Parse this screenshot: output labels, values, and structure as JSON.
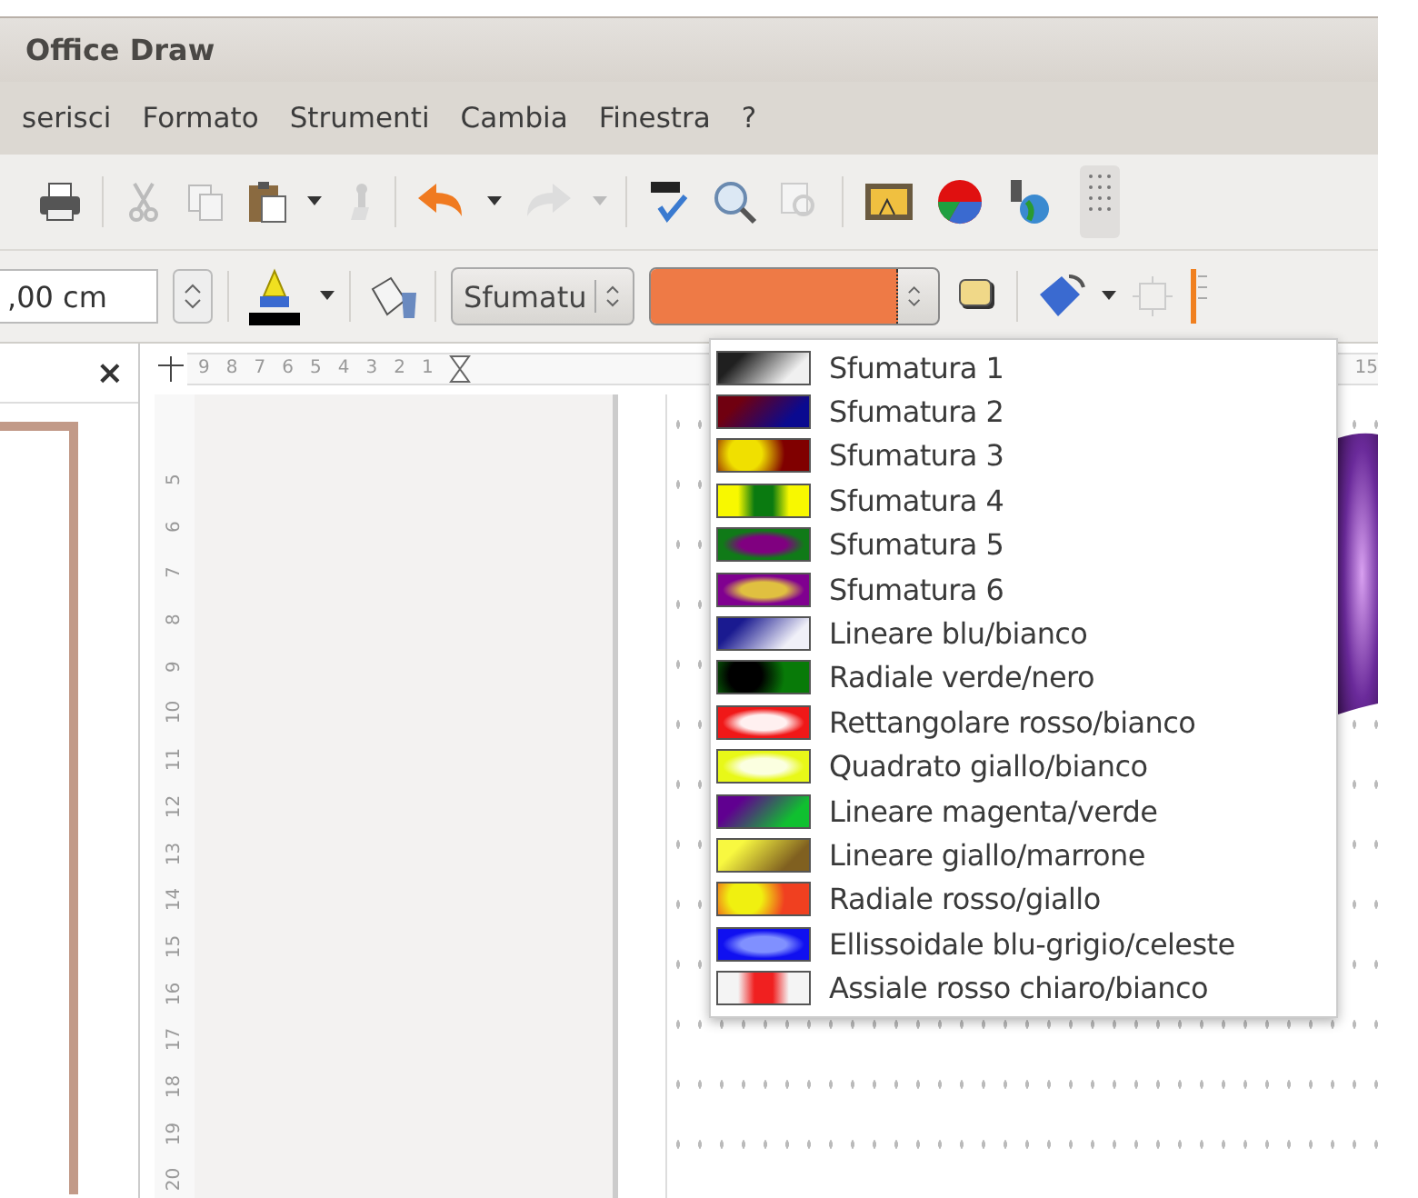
{
  "window": {
    "title": "Office Draw"
  },
  "menu": [
    "serisci",
    "Formato",
    "Strumenti",
    "Cambia",
    "Finestra",
    "?"
  ],
  "line_toolbar": {
    "width_value": ",00 cm",
    "area_style": "Sfumatu",
    "fill": {
      "color": "#ee7a46"
    },
    "fill_expanded": true
  },
  "slides_panel": {
    "close": "×"
  },
  "horizontal_ruler": {
    "labels": [
      "9",
      "8",
      "7",
      "6",
      "5",
      "4",
      "3",
      "2",
      "1"
    ],
    "right_label": "15"
  },
  "vertical_ruler": {
    "labels": [
      "5",
      "6",
      "7",
      "8",
      "9",
      "10",
      "11",
      "12",
      "13",
      "14",
      "15",
      "16",
      "17",
      "18",
      "19",
      "20"
    ]
  },
  "gradient_list": [
    {
      "label": "Sfumatura 1",
      "kind": "linear",
      "stops": [
        {
          "color": "#202020"
        },
        {
          "color": "#f0f0f0"
        }
      ],
      "selected": false
    },
    {
      "label": "Sfumatura 2",
      "kind": "linear",
      "stops": [
        {
          "color": "#700010"
        },
        {
          "color": "#0a0a90"
        }
      ],
      "selected": false
    },
    {
      "label": "Sfumatura 3",
      "kind": "radial",
      "stops": [
        {
          "color": "#f0e000"
        },
        {
          "color": "#800000"
        }
      ],
      "selected": false
    },
    {
      "label": "Sfumatura 4",
      "kind": "axial",
      "stops": [
        {
          "color": "#0a7a10"
        },
        {
          "color": "#f8f800"
        }
      ],
      "selected": false
    },
    {
      "label": "Sfumatura 5",
      "kind": "ellipse",
      "stops": [
        {
          "color": "#800080"
        },
        {
          "color": "#107a18"
        }
      ],
      "selected": false
    },
    {
      "label": "Sfumatura 6",
      "kind": "rect",
      "stops": [
        {
          "color": "#e0c040"
        },
        {
          "color": "#800090"
        }
      ],
      "selected": false
    },
    {
      "label": "Lineare blu/bianco",
      "kind": "linear",
      "stops": [
        {
          "color": "#1a1a90"
        },
        {
          "color": "#f0f0f8"
        }
      ],
      "selected": false
    },
    {
      "label": "Radiale verde/nero",
      "kind": "radial",
      "stops": [
        {
          "color": "#000000"
        },
        {
          "color": "#087a08"
        }
      ],
      "selected": false
    },
    {
      "label": "Rettangolare rosso/bianco",
      "kind": "rect",
      "stops": [
        {
          "color": "#fff0f0"
        },
        {
          "color": "#f01818"
        }
      ],
      "selected": false
    },
    {
      "label": "Quadrato giallo/bianco",
      "kind": "rect",
      "stops": [
        {
          "color": "#fbffe0"
        },
        {
          "color": "#e8f818"
        }
      ],
      "selected": false
    },
    {
      "label": "Lineare magenta/verde",
      "kind": "linear",
      "stops": [
        {
          "color": "#600090"
        },
        {
          "color": "#10c030"
        }
      ],
      "selected": false
    },
    {
      "label": "Lineare giallo/marrone",
      "kind": "linear",
      "stops": [
        {
          "color": "#f8f840"
        },
        {
          "color": "#806020"
        }
      ],
      "selected": false
    },
    {
      "label": "Radiale rosso/giallo",
      "kind": "radial",
      "stops": [
        {
          "color": "#f0f010"
        },
        {
          "color": "#f04020"
        }
      ],
      "selected": false
    },
    {
      "label": "Ellissoidale blu-grigio/celeste",
      "kind": "ellipse",
      "stops": [
        {
          "color": "#8090ff"
        },
        {
          "color": "#1010f0"
        }
      ],
      "selected": false
    },
    {
      "label": "Assiale rosso chiaro/bianco",
      "kind": "axial",
      "stops": [
        {
          "color": "#f02020"
        },
        {
          "color": "#f4f4f4"
        }
      ],
      "selected": false
    }
  ]
}
